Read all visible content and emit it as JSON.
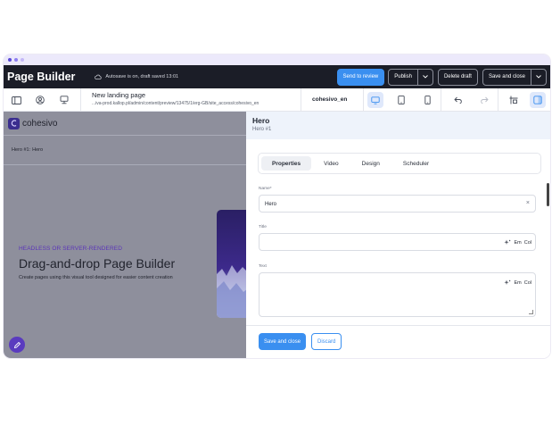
{
  "window": {
    "dots": [
      "#5b4bd8",
      "#8e7ff0",
      "#c4b8f7"
    ]
  },
  "topbar": {
    "brand": "Page Builder",
    "autosave": "Autosave is on, draft saved 13:01",
    "send_review": "Send to review",
    "publish": "Publish",
    "delete_draft": "Delete draft",
    "save_close": "Save and close"
  },
  "toolbar": {
    "page_title": "New landing page",
    "page_url": "...iva-prod.kallop.pl/admin/content/preview/13475/1/erg-GB/site_access/cohesivo_en",
    "language": "cohesivo_en",
    "active_device": "desktop"
  },
  "preview": {
    "logo_text": "cohesivo",
    "breadcrumb_label": "Hero #1:",
    "breadcrumb_value": "Hero",
    "hero_kicker": "HEADLESS OR SERVER-RENDERED",
    "hero_title": "Drag-and-drop Page Builder",
    "hero_subtitle": "Create pages using this visual tool designed for easier content creation"
  },
  "panel": {
    "title": "Hero",
    "subtitle": "Hero #1",
    "tabs": [
      {
        "label": "Properties",
        "active": true
      },
      {
        "label": "Video",
        "active": false
      },
      {
        "label": "Design",
        "active": false
      },
      {
        "label": "Scheduler",
        "active": false
      }
    ],
    "name_label": "Name*",
    "name_value": "Hero",
    "title_label": "Title",
    "title_value": "",
    "text_label": "Text",
    "text_value": "",
    "tool_em": "Em",
    "tool_col": "Col",
    "save_close": "Save and close",
    "discard": "Discard"
  },
  "colors": {
    "accent": "#3a8ff0",
    "brand_purple": "#5a34b8",
    "topbar_bg": "#1b1d27",
    "preview_overlay": "#8e8f9c"
  }
}
